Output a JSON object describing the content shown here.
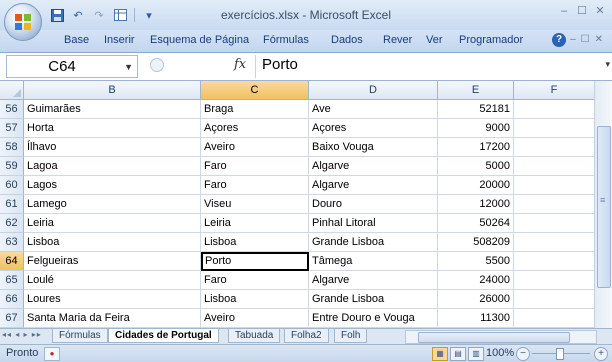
{
  "window": {
    "title": "exercícios.xlsx - Microsoft Excel",
    "controls": [
      "–",
      "☐",
      "✕"
    ]
  },
  "qat": {
    "save": "💾",
    "undo": "↶",
    "redo": "↷",
    "custom": "▾"
  },
  "ribbon": {
    "tabs": [
      "Base",
      "Inserir",
      "Esquema de Página",
      "Fórmulas",
      "Dados",
      "Rever",
      "Ver",
      "Programador"
    ],
    "help": "?"
  },
  "formula_bar": {
    "name_box": "C64",
    "fx": "fx",
    "content": "Porto"
  },
  "grid": {
    "columns": [
      "B",
      "C",
      "D",
      "E",
      "F"
    ],
    "selected_column": "C",
    "rows": [
      {
        "n": "56",
        "b": "Guimarães",
        "c": "Braga",
        "d": "Ave",
        "e": "52181"
      },
      {
        "n": "57",
        "b": "Horta",
        "c": "Açores",
        "d": "Açores",
        "e": "9000"
      },
      {
        "n": "58",
        "b": "Ílhavo",
        "c": "Aveiro",
        "d": "Baixo Vouga",
        "e": "17200"
      },
      {
        "n": "59",
        "b": "Lagoa",
        "c": "Faro",
        "d": "Algarve",
        "e": "5000"
      },
      {
        "n": "60",
        "b": "Lagos",
        "c": "Faro",
        "d": "Algarve",
        "e": "20000"
      },
      {
        "n": "61",
        "b": "Lamego",
        "c": "Viseu",
        "d": "Douro",
        "e": "12000"
      },
      {
        "n": "62",
        "b": "Leiria",
        "c": "Leiria",
        "d": "Pinhal Litoral",
        "e": "50264"
      },
      {
        "n": "63",
        "b": "Lisboa",
        "c": "Lisboa",
        "d": "Grande Lisboa",
        "e": "508209"
      },
      {
        "n": "64",
        "b": "Felgueiras",
        "c": "Porto",
        "d": "Tâmega",
        "e": "5500"
      },
      {
        "n": "65",
        "b": "Loulé",
        "c": "Faro",
        "d": "Algarve",
        "e": "24000"
      },
      {
        "n": "66",
        "b": "Loures",
        "c": "Lisboa",
        "d": "Grande Lisboa",
        "e": "26000"
      },
      {
        "n": "67",
        "b": "Santa Maria da Feira",
        "c": "Aveiro",
        "d": "Entre Douro e Vouga",
        "e": "11300"
      }
    ],
    "active_cell": "C64"
  },
  "sheets": {
    "nav": "◂◂ ◂ ▸ ▸▸",
    "tabs": [
      "Fórmulas",
      "Cidades de Portugal",
      "Tabuada",
      "Folha2",
      "Folh"
    ],
    "active": "Cidades de Portugal"
  },
  "status": {
    "text": "Pronto",
    "zoom": "100%",
    "zoom_minus": "−",
    "zoom_plus": "+"
  }
}
